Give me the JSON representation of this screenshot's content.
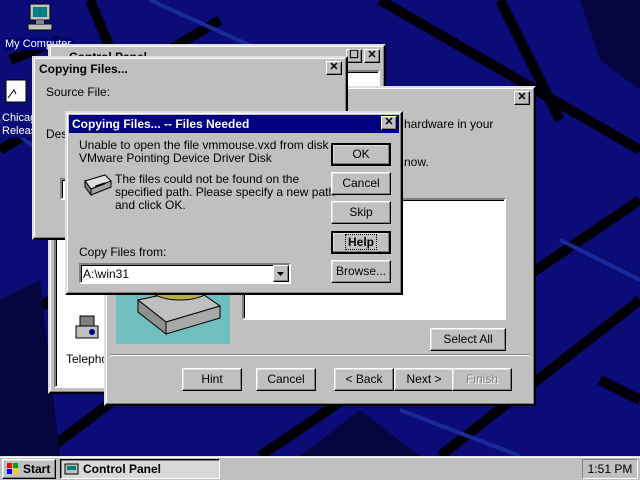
{
  "desktop": {
    "icons": [
      {
        "label": "My Computer"
      },
      {
        "label": "Chicago Release"
      }
    ]
  },
  "windows": {
    "control_panel": {
      "title": "Control Panel",
      "item_label": "Telephony"
    },
    "add_hardware": {
      "text_line1": "hardware in your",
      "text_line2": "now.",
      "select_all": "Select All",
      "hint": "Hint",
      "cancel": "Cancel",
      "back": "< Back",
      "next": "Next >",
      "finish": "Finish"
    },
    "copying": {
      "title": "Copying Files...",
      "source_label": "Source File:",
      "dest_label": "Destination File:"
    },
    "files_needed": {
      "title": "Copying Files... -- Files Needed",
      "message_line1": "Unable to open the file vmmouse.vxd from disk",
      "message_line2": "VMware Pointing Device Driver Disk",
      "detail_line1": "The files could not be found on the",
      "detail_line2": "specified path. Please specify a new path",
      "detail_line3": "and click OK.",
      "copy_from_label": "Copy Files from:",
      "copy_from_value": "A:\\win31",
      "ok": "OK",
      "cancel": "Cancel",
      "skip": "Skip",
      "help": "Help",
      "browse": "Browse..."
    }
  },
  "taskbar": {
    "start": "Start",
    "task_label": "Control Panel",
    "clock": "1:51 PM"
  },
  "colors": {
    "desktop": "#0c0c78",
    "title_active": "#000080",
    "face": "#c0c0c0"
  }
}
